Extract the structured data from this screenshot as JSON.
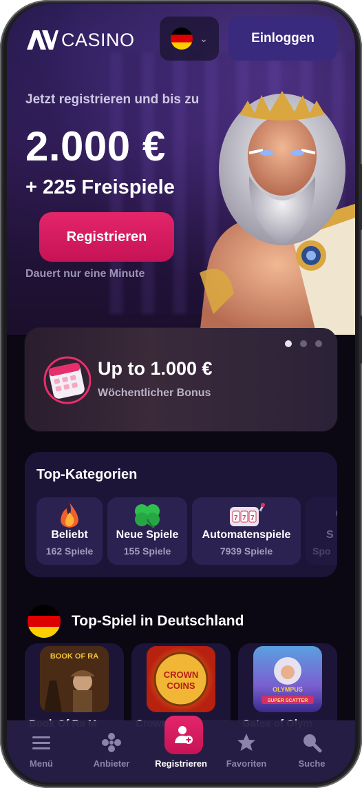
{
  "header": {
    "logo_text": "CASINO",
    "language_flag": "germany-flag",
    "login_label": "Einloggen"
  },
  "hero": {
    "subtitle": "Jetzt registrieren und bis zu",
    "amount": "2.000 €",
    "free_spins": "+ 225 Freispiele",
    "register_label": "Registrieren",
    "note": "Dauert nur eine Minute"
  },
  "promo": {
    "title": "Up to 1.000 €",
    "subtitle": "Wöchentlicher Bonus",
    "slides": 3,
    "active_slide": 1
  },
  "categories": {
    "title": "Top-Kategorien",
    "items": [
      {
        "name": "Beliebt",
        "count": "162 Spiele",
        "icon": "fire-icon"
      },
      {
        "name": "Neue Spiele",
        "count": "155 Spiele",
        "icon": "clover-icon"
      },
      {
        "name": "Automatenspiele",
        "count": "7939 Spiele",
        "icon": "slot-machine-icon"
      },
      {
        "name": "S",
        "count": "Spo",
        "icon": "sport-icon"
      }
    ]
  },
  "top_games": {
    "title": "Top-Spiel in Deutschland",
    "items": [
      {
        "name": "Book Of Ra M",
        "thumb_text": "BOOK OF RA"
      },
      {
        "name": "Crown Coins",
        "thumb_text": "CROWN COINS"
      },
      {
        "name": "Gates of Olym",
        "thumb_text": "GATES OF OLYMPUS",
        "thumb_sub": "SUPER SCATTER"
      }
    ]
  },
  "bottom_nav": {
    "items": [
      {
        "label": "Menü",
        "icon": "menu-icon"
      },
      {
        "label": "Anbieter",
        "icon": "providers-icon"
      },
      {
        "label": "Registrieren",
        "icon": "add-user-icon"
      },
      {
        "label": "Favoriten",
        "icon": "star-icon"
      },
      {
        "label": "Suche",
        "icon": "search-icon"
      }
    ]
  }
}
